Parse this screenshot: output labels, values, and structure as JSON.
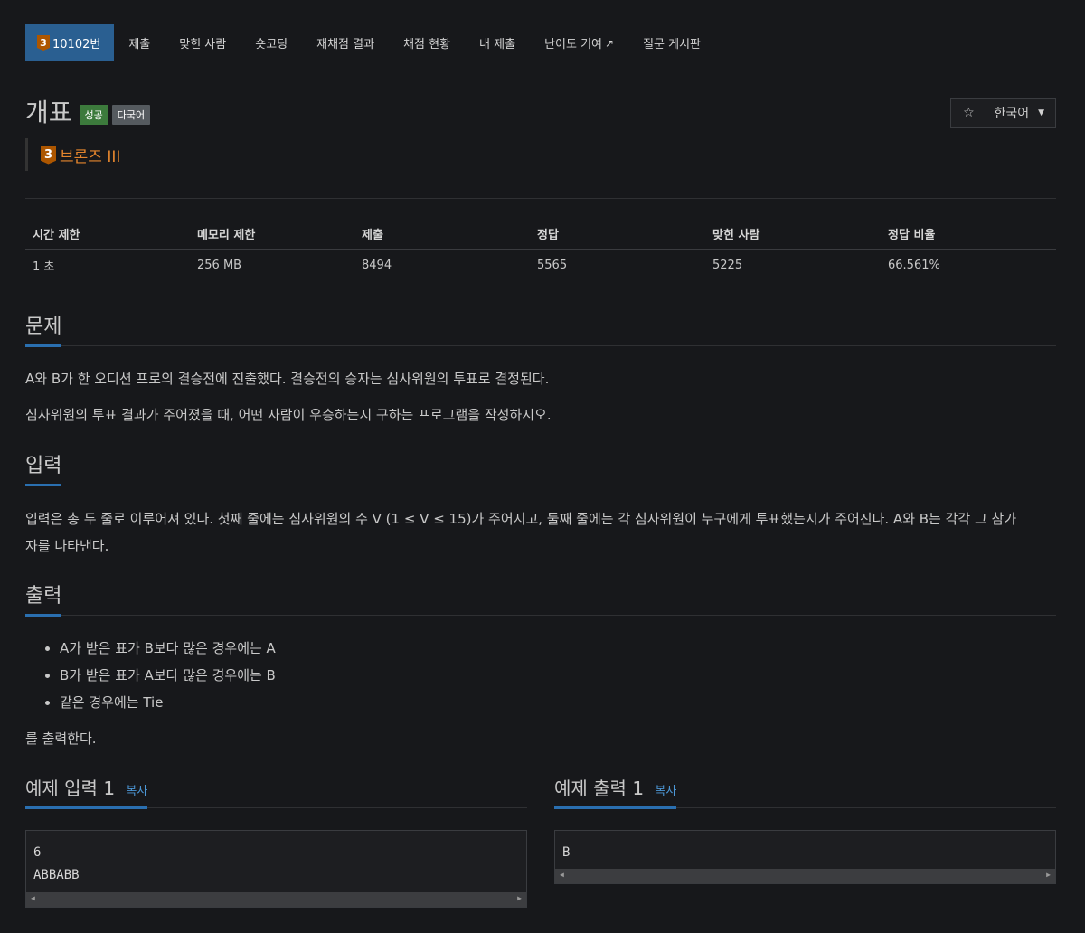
{
  "nav": {
    "problem_tab": "10102번",
    "tier_number": "3",
    "items": [
      "제출",
      "맞힌 사람",
      "숏코딩",
      "재채점 결과",
      "채점 현황",
      "내 제출",
      "난이도 기여",
      "질문 게시판"
    ]
  },
  "problem": {
    "title": "개표",
    "label_success": "성공",
    "label_multilang": "다국어",
    "tier_number": "3",
    "tier_name": "브론즈 III"
  },
  "tools": {
    "star": "☆",
    "language": "한국어"
  },
  "stats": {
    "headers": [
      "시간 제한",
      "메모리 제한",
      "제출",
      "정답",
      "맞힌 사람",
      "정답 비율"
    ],
    "values": [
      "1 초",
      "256 MB",
      "8494",
      "5565",
      "5225",
      "66.561%"
    ]
  },
  "sections": {
    "problem_title": "문제",
    "problem_p1": "A와 B가 한 오디션 프로의 결승전에 진출했다. 결승전의 승자는 심사위원의 투표로 결정된다.",
    "problem_p2": "심사위원의 투표 결과가 주어졌을 때, 어떤 사람이 우승하는지 구하는 프로그램을 작성하시오.",
    "input_title": "입력",
    "input_line1": "입력은 총 두 줄로 이루어져 있다. 첫째 줄에는 심사위원의 수 V (1 ≤  V ≤  15)가 주어지고, 둘째 줄에는 각 심사위원이 누구에게 투표했는지가 주어진다. A와 B는 각각 그 참가",
    "input_line2": "자를 나타낸다.",
    "output_title": "출력",
    "output_items": [
      "A가 받은 표가 B보다 많은 경우에는 A",
      "B가 받은 표가 A보다 많은 경우에는 B",
      "같은 경우에는 Tie"
    ],
    "output_tail": "를 출력한다."
  },
  "samples": {
    "copy_label": "복사",
    "input_title": "예제 입력 1",
    "input_text": "6\nABBABB",
    "output_title": "예제 출력 1",
    "output_text": "B"
  },
  "colors": {
    "accent": "#2a6fb0",
    "tier": "#e4852d",
    "success": "#3c7a3c"
  }
}
